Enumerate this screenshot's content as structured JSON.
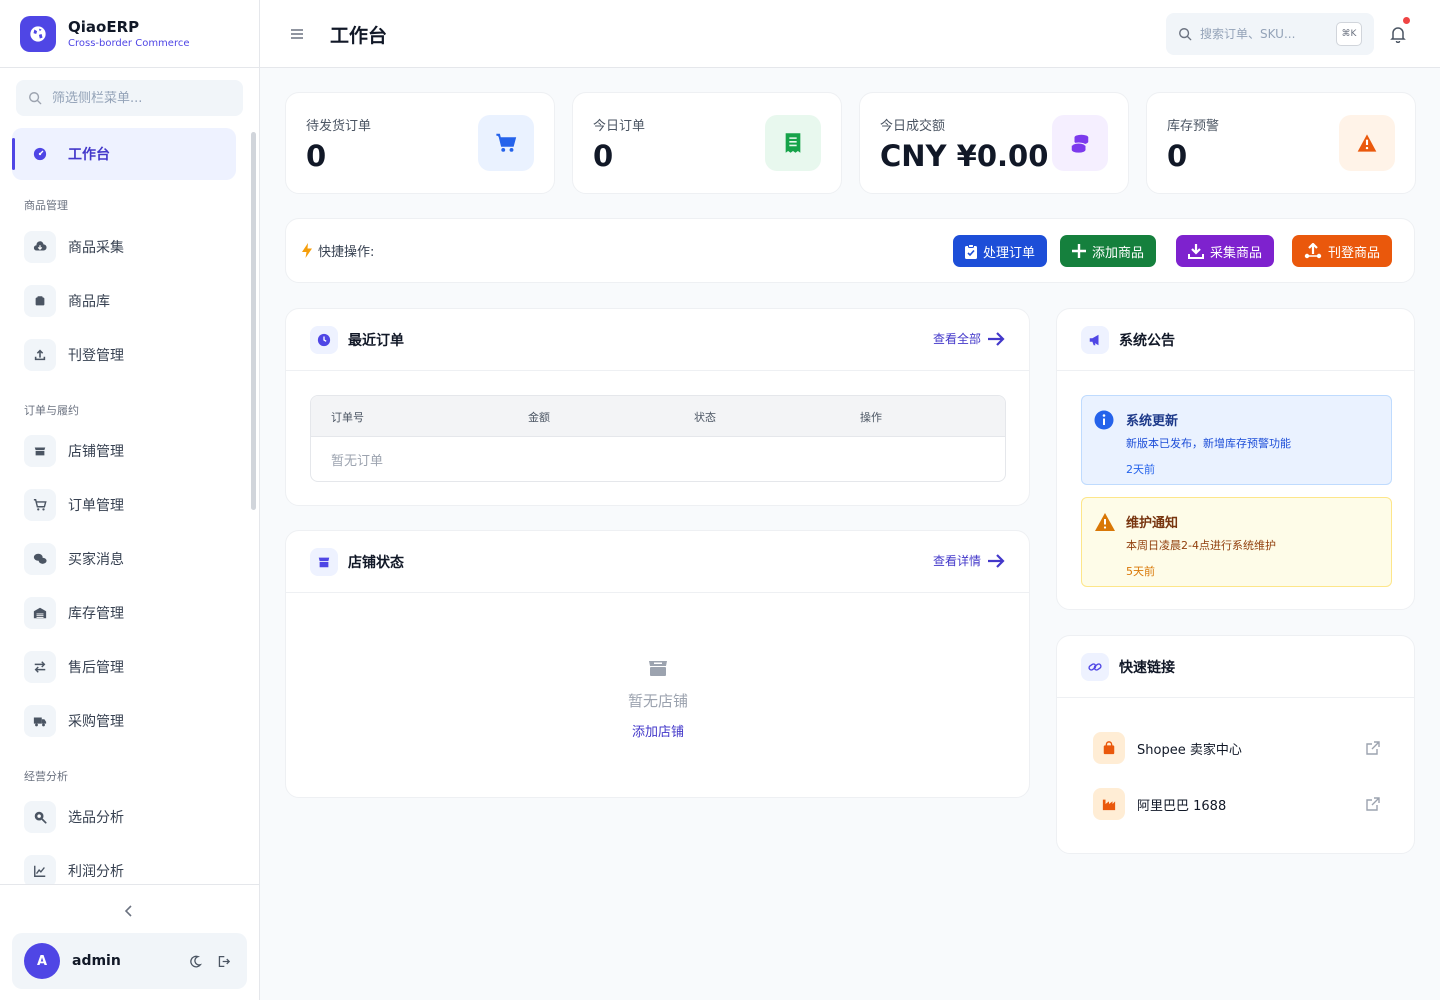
{
  "brand": {
    "name": "QiaoERP",
    "subtitle": "Cross-border Commerce"
  },
  "sidebar": {
    "search_placeholder": "筛选侧栏菜单...",
    "items": [
      {
        "label": "工作台",
        "icon": "dashboard-icon",
        "active": true
      },
      {
        "group": "商品管理"
      },
      {
        "label": "商品采集",
        "icon": "cloud-download-icon"
      },
      {
        "label": "商品库",
        "icon": "box-icon"
      },
      {
        "label": "刊登管理",
        "icon": "upload-icon"
      },
      {
        "group": "订单与履约"
      },
      {
        "label": "店铺管理",
        "icon": "store-icon"
      },
      {
        "label": "订单管理",
        "icon": "cart-icon"
      },
      {
        "label": "买家消息",
        "icon": "chat-icon"
      },
      {
        "label": "库存管理",
        "icon": "warehouse-icon"
      },
      {
        "label": "售后管理",
        "icon": "exchange-icon"
      },
      {
        "label": "采购管理",
        "icon": "truck-icon"
      },
      {
        "group": "经营分析"
      },
      {
        "label": "选品分析",
        "icon": "search-analytics-icon"
      },
      {
        "label": "利润分析",
        "icon": "chart-line-icon"
      }
    ],
    "groups": {
      "g1": "商品管理",
      "g2": "订单与履约",
      "g3": "经营分析"
    },
    "labels": {
      "i0": "工作台",
      "i1": "商品采集",
      "i2": "商品库",
      "i3": "刊登管理",
      "i4": "店铺管理",
      "i5": "订单管理",
      "i6": "买家消息",
      "i7": "库存管理",
      "i8": "售后管理",
      "i9": "采购管理",
      "i10": "选品分析",
      "i11": "利润分析"
    },
    "user": {
      "initial": "A",
      "name": "admin"
    }
  },
  "header": {
    "title": "工作台",
    "search_placeholder": "搜索订单、SKU...",
    "shortcut": "⌘K"
  },
  "stats": {
    "pending": {
      "label": "待发货订单",
      "value": "0",
      "icon": "cart-icon",
      "color": "#2563eb"
    },
    "today_orders": {
      "label": "今日订单",
      "value": "0",
      "icon": "receipt-icon",
      "color": "#16a34a"
    },
    "today_sales": {
      "label": "今日成交额",
      "value": "CNY ¥0.00",
      "icon": "coins-icon",
      "color": "#7c3aed"
    },
    "stock_alert": {
      "label": "库存预警",
      "value": "0",
      "icon": "warning-icon",
      "color": "#ea580c"
    }
  },
  "quick_actions": {
    "label": "快捷操作:",
    "process_orders": {
      "label": "处理订单",
      "color": "#1d4ed8"
    },
    "add_product": {
      "label": "添加商品",
      "color": "#15803d"
    },
    "collect_product": {
      "label": "采集商品",
      "color": "#7e22ce"
    },
    "list_product": {
      "label": "刊登商品",
      "color": "#ea580c"
    }
  },
  "recent_orders": {
    "title": "最近订单",
    "view_all": "查看全部",
    "columns": [
      "订单号",
      "金额",
      "状态",
      "操作"
    ],
    "empty": "暂无订单"
  },
  "store_status": {
    "title": "店铺状态",
    "view_details": "查看详情",
    "empty": "暂无店铺",
    "add_store": "添加店铺"
  },
  "announcements": {
    "title": "系统公告",
    "items": [
      {
        "title": "系统更新",
        "body": "新版本已发布，新增库存预警功能",
        "time": "2天前",
        "type": "info"
      },
      {
        "title": "维护通知",
        "body": "本周日凌晨2-4点进行系统维护",
        "time": "5天前",
        "type": "warning"
      }
    ]
  },
  "quick_links": {
    "title": "快速链接",
    "items": [
      {
        "label": "Shopee 卖家中心",
        "icon": "shopping-bag-icon"
      },
      {
        "label": "阿里巴巴 1688",
        "icon": "factory-icon"
      }
    ]
  }
}
